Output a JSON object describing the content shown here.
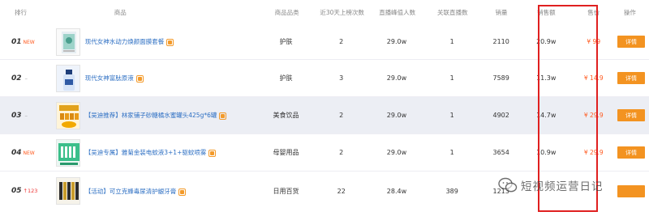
{
  "header": {
    "rank": "排行",
    "product": "商品",
    "category": "商品品类",
    "listed_30d": "近30天上榜次数",
    "live_peak": "直播峰值人数",
    "related_live": "关联直播数",
    "sales": "销量",
    "sales_amount": "销售额",
    "price": "售价",
    "action": "操作"
  },
  "rows": [
    {
      "rank": "01",
      "change": "NEW",
      "title": "现代女神水动力焕颜面膜套餐",
      "category": "护肤",
      "listed_30d": "2",
      "live_peak": "29.0w",
      "related_live": "1",
      "sales": "2110",
      "sales_amount": "20.9w",
      "price": "¥ 99",
      "action": "详情"
    },
    {
      "rank": "02",
      "change": "–",
      "title": "现代女神富肽原液",
      "category": "护肤",
      "listed_30d": "3",
      "live_peak": "29.0w",
      "related_live": "1",
      "sales": "7589",
      "sales_amount": "11.3w",
      "price": "¥ 14.9",
      "action": "详情"
    },
    {
      "rank": "03",
      "change": "–",
      "title": "【吴迪推荐】林家铺子砂糖橘水蜜罐头425g*6罐",
      "category": "美食饮品",
      "listed_30d": "2",
      "live_peak": "29.0w",
      "related_live": "1",
      "sales": "4902",
      "sales_amount": "14.7w",
      "price": "¥ 29.9",
      "action": "详情"
    },
    {
      "rank": "04",
      "change": "NEW",
      "title": "【吴迪专属】雅菊金装电蚊液3+1+驱蚊喷雾",
      "category": "母婴用品",
      "listed_30d": "2",
      "live_peak": "29.0w",
      "related_live": "1",
      "sales": "3654",
      "sales_amount": "10.9w",
      "price": "¥ 29.9",
      "action": "详情"
    },
    {
      "rank": "05",
      "change": "↑123",
      "title": "【活动】可立克蜂毒尿清护龈牙膏",
      "category": "日用百货",
      "listed_30d": "22",
      "live_peak": "28.4w",
      "related_live": "389",
      "sales": "1213",
      "sales_amount": "",
      "price": "",
      "action": ""
    }
  ],
  "watermark": "短视频运营日记",
  "colors": {
    "accent": "#f39321",
    "price": "#ff5a1f",
    "link": "#2d6fc3",
    "highlight_frame": "#e02020",
    "row_highlight": "#eceef4"
  }
}
